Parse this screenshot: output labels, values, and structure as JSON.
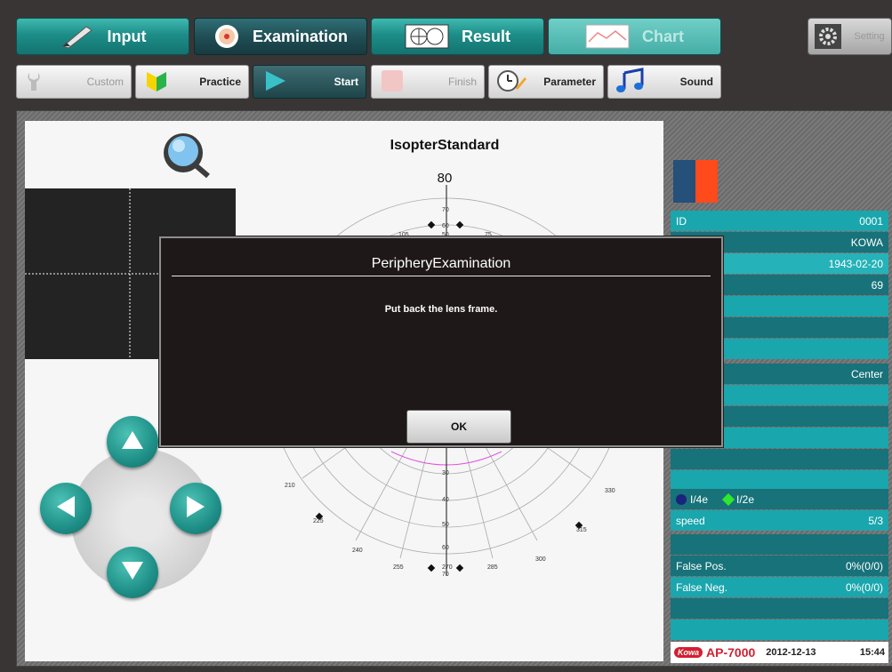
{
  "tabs": [
    {
      "label": "Input"
    },
    {
      "label": "Examination"
    },
    {
      "label": "Result"
    },
    {
      "label": "Chart"
    },
    {
      "label": "Setting"
    }
  ],
  "toolbar": {
    "custom": "Custom",
    "practice": "Practice",
    "start": "Start",
    "finish": "Finish",
    "parameter": "Parameter",
    "sound": "Sound"
  },
  "chart": {
    "title": "IsopterStandard",
    "top_value": "80",
    "labels": [
      "70",
      "60",
      "50",
      "105",
      "75",
      "210",
      "330",
      "225",
      "315",
      "240",
      "300",
      "255",
      "285",
      "270",
      "30",
      "40",
      "50",
      "60",
      "70"
    ]
  },
  "patient": {
    "id_label": "ID",
    "id_value": "0001",
    "name": "KOWA",
    "birth": "1943-02-20",
    "age": "69",
    "fixation": "Center"
  },
  "legend": {
    "target1": "I/4e",
    "target2": "I/2e",
    "target1_color": "#1a237e",
    "target2_color": "#2ee82e",
    "speed_label": "speed",
    "speed_value": "5/3"
  },
  "reliability": {
    "false_pos_label": "False Pos.",
    "false_pos_value": "0%(0/0)",
    "false_neg_label": "False Neg.",
    "false_neg_value": "0%(0/0)"
  },
  "footer": {
    "brand": "Kowa",
    "model": "AP-7000",
    "date": "2012-12-13",
    "time": "15:44"
  },
  "dialog": {
    "title": "PeripheryExamination",
    "message": "Put back the lens frame.",
    "ok": "OK"
  },
  "colors": {
    "accent": "#1d8d88",
    "eye_swatch_left": "#24507a",
    "eye_swatch_right": "#ff4a1c"
  }
}
